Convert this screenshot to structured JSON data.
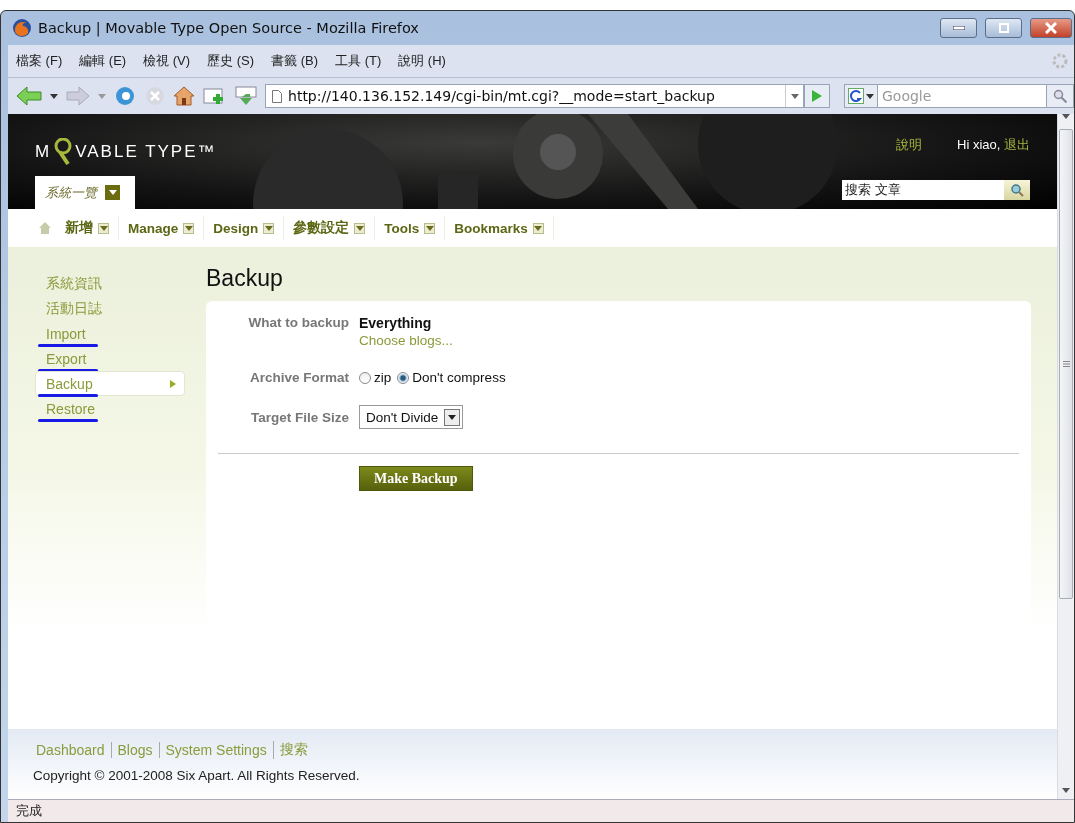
{
  "window": {
    "title": "Backup | Movable Type Open Source - Mozilla Firefox"
  },
  "menu": [
    "檔案 (F)",
    "編輯 (E)",
    "檢視 (V)",
    "歷史 (S)",
    "書籤 (B)",
    "工具 (T)",
    "說明 (H)"
  ],
  "address": {
    "value": "http://140.136.152.149/cgi-bin/mt.cgi?__mode=start_backup"
  },
  "web_search": {
    "placeholder": "Google"
  },
  "header": {
    "logo_start": "M",
    "logo_end": "VABLE TYPE™",
    "blog_selector": "系統一覽",
    "help_link": "說明",
    "greeting": "Hi xiao,",
    "logout_link": "退出",
    "search": {
      "value": "搜索 文章"
    }
  },
  "nav": [
    "新增",
    "Manage",
    "Design",
    "參數設定",
    "Tools",
    "Bookmarks"
  ],
  "sidebar": {
    "items": [
      {
        "label": "系統資訊",
        "selected": false,
        "marked": false
      },
      {
        "label": "活動日誌",
        "selected": false,
        "marked": false
      },
      {
        "label": "Import",
        "selected": false,
        "marked": true
      },
      {
        "label": "Export",
        "selected": false,
        "marked": true
      },
      {
        "label": "Backup",
        "selected": true,
        "marked": true
      },
      {
        "label": "Restore",
        "selected": false,
        "marked": true
      }
    ]
  },
  "main": {
    "title": "Backup",
    "what_to_backup": {
      "label": "What to backup",
      "value": "Everything",
      "link": "Choose blogs..."
    },
    "archive_format": {
      "label": "Archive Format",
      "options": [
        {
          "label": "zip",
          "selected": false
        },
        {
          "label": "Don't compress",
          "selected": true
        }
      ]
    },
    "target_file_size": {
      "label": "Target File Size",
      "value": "Don't Divide"
    },
    "button": "Make Backup"
  },
  "footer": {
    "links": [
      "Dashboard",
      "Blogs",
      "System Settings",
      "搜索"
    ],
    "copyright": "Copyright © 2001-2008 Six Apart. All Rights Reserved."
  },
  "status_bar": "完成"
}
